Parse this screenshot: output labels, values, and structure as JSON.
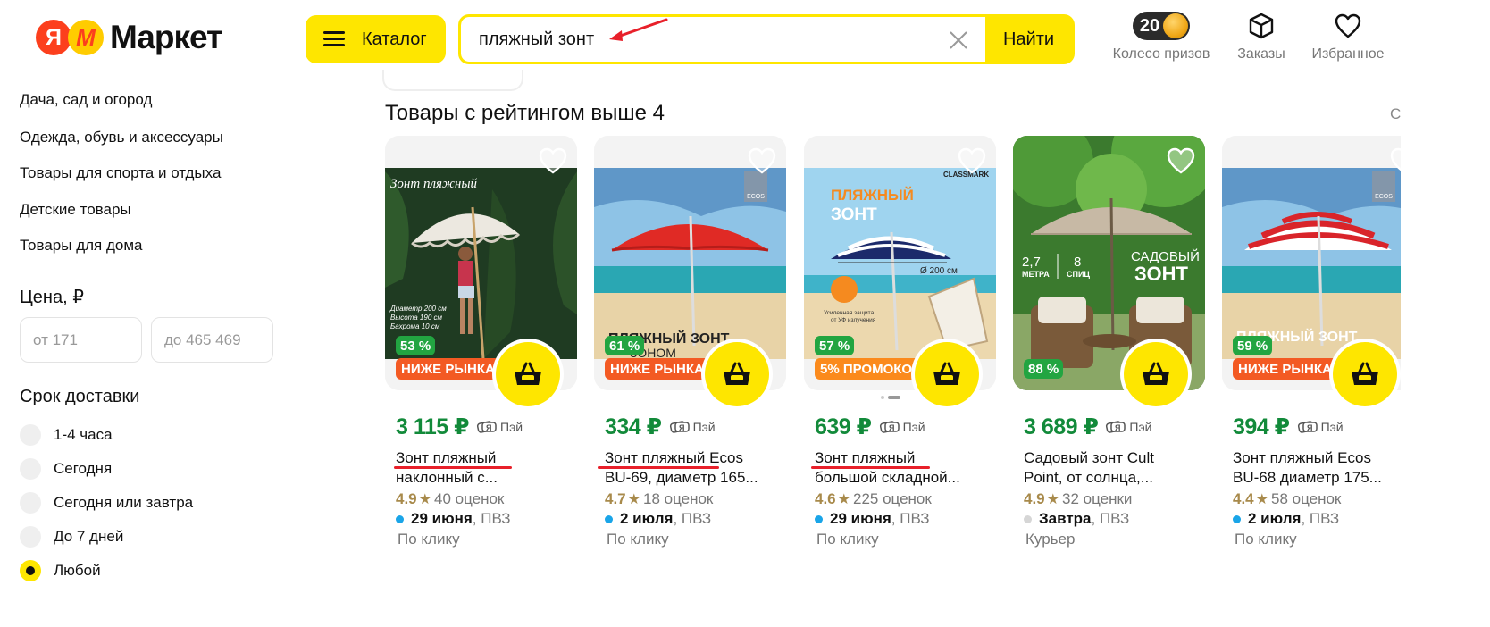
{
  "header": {
    "logo_ya": "Я",
    "logo_m": "M",
    "logo_text": "Маркет",
    "catalog_label": "Каталог",
    "search_value": "пляжный зонт",
    "search_button": "Найти",
    "prize_count": "20",
    "prize_label": "Колесо призов",
    "orders_label": "Заказы",
    "favorites_label": "Избранное"
  },
  "sidebar": {
    "categories": [
      "Дача, сад и огород",
      "Одежда, обувь и аксессуары",
      "Товары для спорта и отдыха",
      "Детские товары",
      "Товары для дома"
    ],
    "price_title": "Цена, ₽",
    "price_from_placeholder": "от 171",
    "price_to_placeholder": "до 465 469",
    "delivery_title": "Срок доставки",
    "delivery_options": [
      "1-4 часа",
      "Сегодня",
      "Сегодня или завтра",
      "До 7 дней",
      "Любой"
    ],
    "delivery_selected": "Любой"
  },
  "main": {
    "section_title": "Товары с рейтингом выше 4",
    "see_all": "С",
    "pay_label": "Пэй",
    "products": [
      {
        "price": "3 115 ₽",
        "name1": "Зонт пляжный",
        "name2": "наклонный с...",
        "rating": "4.9",
        "reviews": "40 оценок",
        "date": "29 июня",
        "place": ", ПВЗ",
        "note": "По клику",
        "rate_badge": "53 %",
        "promo": "НИЖЕ РЫНКА",
        "img_caption": "Зонт пляжный",
        "img_specs": [
          "Диаметр 200 см",
          "Высота 190 см",
          "Бахрома 10 см"
        ]
      },
      {
        "price": "334 ₽",
        "name1": "Зонт пляжный Ecos",
        "name2": "BU-69, диаметр 165...",
        "rating": "4.7",
        "reviews": "18 оценок",
        "date": "2 июля",
        "place": ", ПВЗ",
        "note": "По клику",
        "rate_badge": "61 %",
        "promo": "НИЖЕ РЫНКА",
        "img_caption": "ПЛЯЖНЫЙ ЗОНТ",
        "img_sub": "ЗОНОМ",
        "img_brand": "ECOS"
      },
      {
        "price": "639 ₽",
        "name1": "Зонт пляжный",
        "name2": "большой складной...",
        "rating": "4.6",
        "reviews": "225 оценок",
        "date": "29 июня",
        "place": ", ПВЗ",
        "note": "По клику",
        "rate_badge": "57 %",
        "promo": "5% ПРОМОКОД",
        "img_brand": "CLASSMARK",
        "img_title1": "ПЛЯЖНЫЙ",
        "img_title2": "ЗОНТ",
        "img_diameter": "Ø 200 см",
        "img_note1": "Усиленная защита",
        "img_note2": "от УФ излучения"
      },
      {
        "price": "3 689 ₽",
        "name1": "Садовый зонт Cult",
        "name2": "Point, от солнца,...",
        "rating": "4.9",
        "reviews": "32 оценки",
        "date": "Завтра",
        "place": ", ПВЗ",
        "note": "Курьер",
        "rate_badge": "88 %",
        "promo": "",
        "img_spec1": "2,7",
        "img_spec1_unit": "МЕТРА",
        "img_spec2": "8",
        "img_spec2_unit": "СПИЦ",
        "img_title1": "САДОВЫЙ",
        "img_title2": "ЗОНТ"
      },
      {
        "price": "394 ₽",
        "name1": "Зонт пляжный Ecos",
        "name2": "BU-68 диаметр 175...",
        "rating": "4.4",
        "reviews": "58 оценок",
        "date": "2 июля",
        "place": ", ПВЗ",
        "note": "По клику",
        "rate_badge": "59 %",
        "promo": "НИЖЕ РЫНКА",
        "img_caption": "ПЛЯЖНЫЙ ЗОНТ",
        "img_brand": "ECOS"
      }
    ]
  },
  "colors": {
    "yellow": "#fee600",
    "price_green": "#128a3a",
    "badge_green": "#22a541",
    "promo_orange": "#f35a23",
    "promo_orange2": "#fb8a1c",
    "underline_red": "#e8202a",
    "rating_gold": "#a88a4b",
    "dot_blue": "#1aa5e8",
    "dot_gray": "#ccc"
  }
}
